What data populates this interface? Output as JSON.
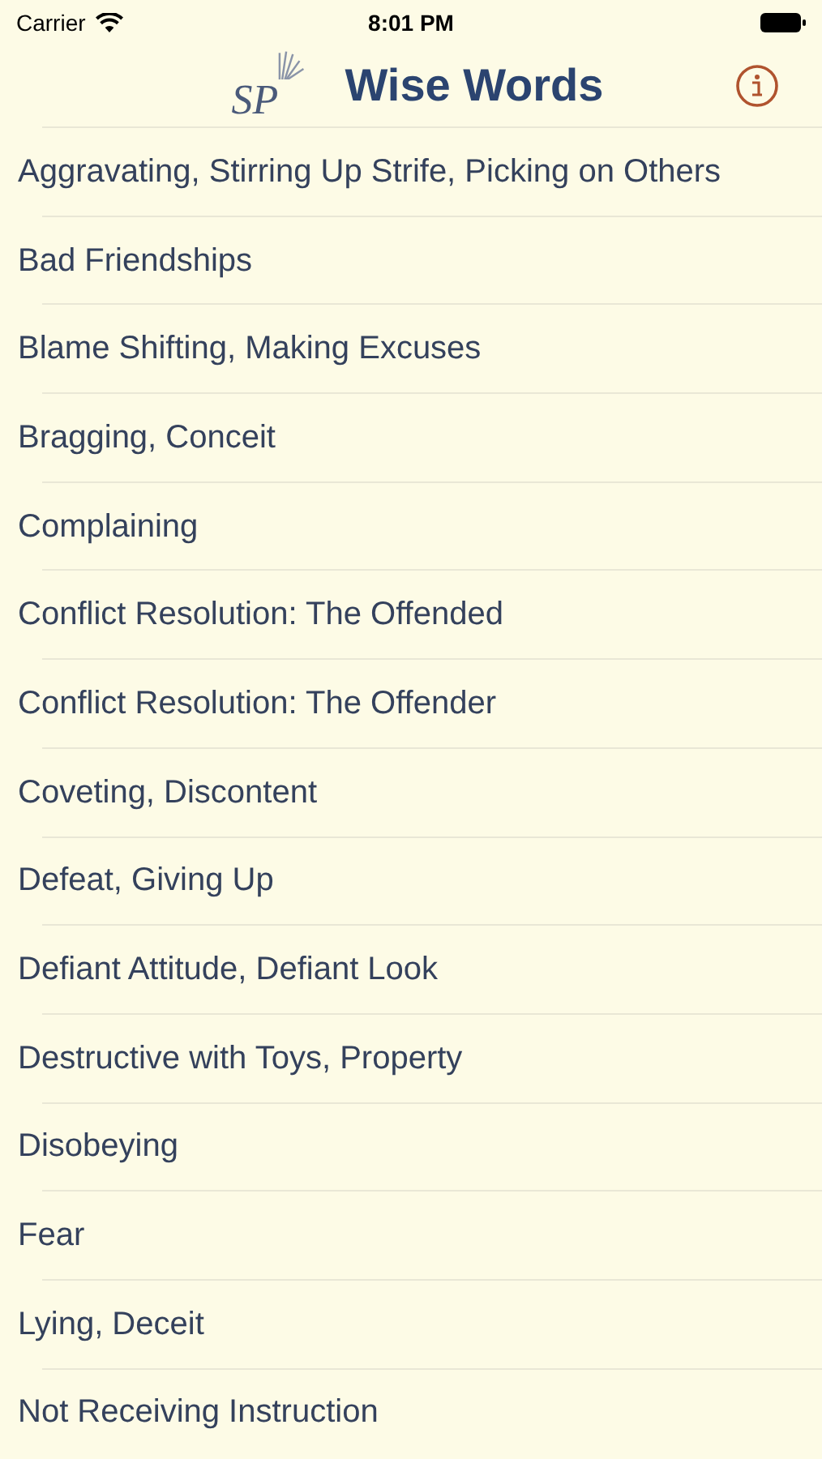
{
  "status_bar": {
    "carrier": "Carrier",
    "time": "8:01 PM"
  },
  "nav_bar": {
    "logo_text": "SP",
    "title": "Wise Words"
  },
  "topics": [
    "Aggravating, Stirring Up Strife, Picking on Others",
    "Bad Friendships",
    "Blame Shifting, Making Excuses",
    "Bragging, Conceit",
    "Complaining",
    "Conflict Resolution: The Offended",
    "Conflict Resolution: The Offender",
    "Coveting, Discontent",
    "Defeat, Giving Up",
    "Defiant Attitude, Defiant Look",
    "Destructive with Toys, Property",
    "Disobeying",
    "Fear",
    "Lying, Deceit",
    "Not Receiving Instruction"
  ]
}
